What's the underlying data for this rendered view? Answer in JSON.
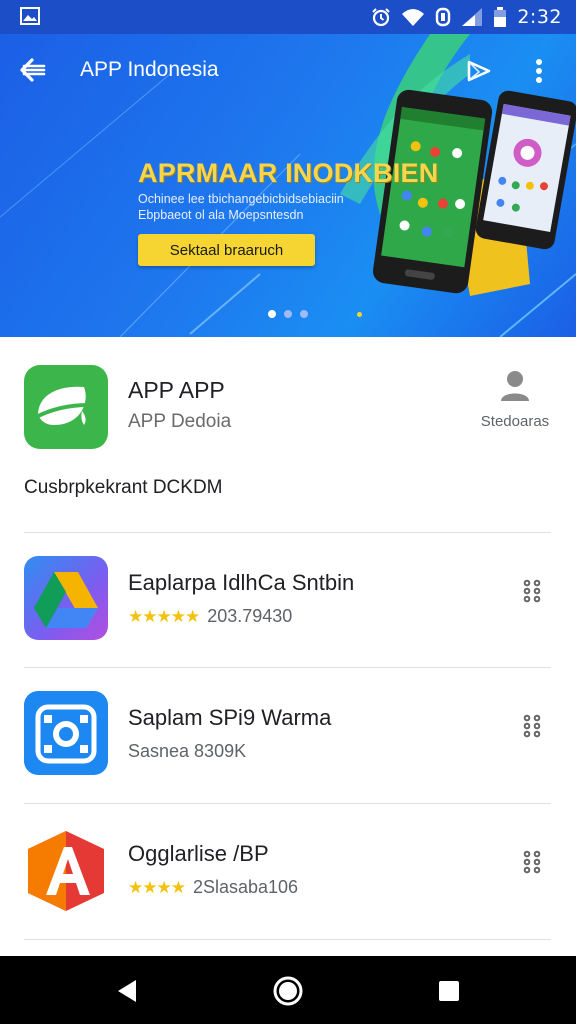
{
  "status_bar": {
    "time": "2:32",
    "icons": [
      "image-icon",
      "alarm-icon",
      "wifi-icon",
      "data-saver-icon",
      "signal-icon",
      "battery-icon"
    ]
  },
  "app_bar": {
    "title": "APP Indonesia",
    "back_icon": "back-arrow-icon",
    "action_icon": "play-store-icon",
    "more_icon": "more-vert-icon"
  },
  "banner": {
    "headline": "APRMAAR INODKBIEN",
    "line1": "Ochinee lee tbichangebicbidsebiaciin",
    "line2": "Ebpbaeot ol ala Moepsntesdn",
    "button_label": "Sektaal braaruch",
    "page_indicator": {
      "count": 3,
      "active": 0
    },
    "accent_color": "#f6d533",
    "background_color": "#1b6fea"
  },
  "featured": {
    "name": "APP APP",
    "developer": "APP Dedoia",
    "action_label": "Stedoaras",
    "description": "Cusbrpkekrant DCKDM",
    "icon_color": "#3cb64a"
  },
  "apps": [
    {
      "title": "Eaplarpa IdlhCa Sntbin",
      "stars_text": "★★★★★",
      "meta": "203.79430",
      "icon": "drive-icon",
      "menu_icon": "dots-menu-icon"
    },
    {
      "title": "Saplam SPi9 Warma",
      "stars_text": "",
      "meta": "Sasnea 8309K",
      "icon": "camera-lens-icon",
      "menu_icon": "dots-menu-icon"
    },
    {
      "title": "Ogglarlise /BP",
      "stars_text": "★★★★",
      "meta": "2Slasaba106",
      "icon": "letter-a-icon",
      "menu_icon": "dots-menu-icon"
    }
  ],
  "nav": {
    "back": "nav-back-icon",
    "home": "nav-home-icon",
    "recents": "nav-recents-icon"
  }
}
